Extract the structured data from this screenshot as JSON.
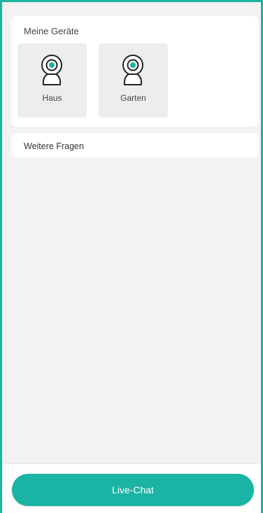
{
  "colors": {
    "accent": "#1bb3a3",
    "background": "#f2f2f0",
    "tile": "#ebedee"
  },
  "devices_section": {
    "title": "Meine Geräte",
    "devices": [
      {
        "name": "Haus",
        "icon": "camera-icon"
      },
      {
        "name": "Garten",
        "icon": "camera-icon"
      }
    ]
  },
  "faq_section": {
    "title": "Weitere Fragen"
  },
  "footer": {
    "live_chat_label": "Live-Chat"
  }
}
